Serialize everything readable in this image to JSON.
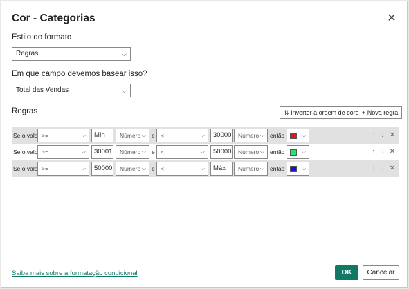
{
  "dialog": {
    "title": "Cor - Categorias",
    "close_icon": "close-icon"
  },
  "format_style": {
    "label": "Estilo do formato",
    "value": "Regras"
  },
  "base_field": {
    "label": "Em que campo devemos basear isso?",
    "value": "Total das Vendas"
  },
  "rules_section": {
    "label": "Regras",
    "reverse_button": "Inverter a ordem de cores",
    "new_rule_button": "Nova regra"
  },
  "rules": [
    {
      "if_label": "Se o valor",
      "op1": ">=",
      "val1": "Mín",
      "type1": "Número",
      "and_label": "e",
      "op2": "<",
      "val2": "30000",
      "type2": "Número",
      "then_label": "então",
      "color": "#e81123"
    },
    {
      "if_label": "Se o valor",
      "op1": ">=",
      "val1": "30001",
      "type1": "Número",
      "and_label": "e",
      "op2": "<",
      "val2": "50000",
      "type2": "Número",
      "then_label": "então",
      "color": "#1aeb6a"
    },
    {
      "if_label": "Se o valor",
      "op1": ">=",
      "val1": "50000",
      "type1": "Número",
      "and_label": "e",
      "op2": "<",
      "val2": "Máx",
      "type2": "Número",
      "then_label": "então",
      "color": "#1414d8"
    }
  ],
  "footer": {
    "learn_more_link": "Saiba mais sobre a formatação condicional",
    "ok": "OK",
    "cancel": "Cancelar"
  }
}
